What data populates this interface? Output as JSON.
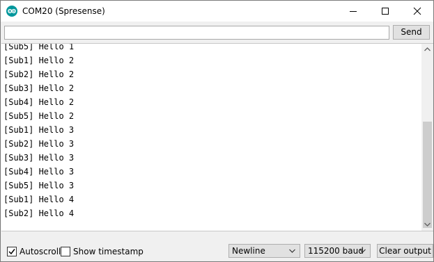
{
  "window": {
    "title": "COM20 (Spresense)",
    "icon": "arduino-logo-icon",
    "accent_color": "#00979c"
  },
  "send_row": {
    "input_value": "",
    "send_label": "Send"
  },
  "serial_output": {
    "lines": [
      "[Sub5] Hello 1",
      "[Sub1] Hello 2",
      "[Sub2] Hello 2",
      "[Sub3] Hello 2",
      "[Sub4] Hello 2",
      "[Sub5] Hello 2",
      "[Sub1] Hello 3",
      "[Sub2] Hello 3",
      "[Sub3] Hello 3",
      "[Sub4] Hello 3",
      "[Sub5] Hello 3",
      "[Sub1] Hello 4",
      "[Sub2] Hello 4"
    ]
  },
  "bottom_bar": {
    "autoscroll": {
      "label": "Autoscroll",
      "checked": true
    },
    "show_timestamp": {
      "label": "Show timestamp",
      "checked": false
    },
    "line_ending": "Newline",
    "baud_rate": "115200 baud",
    "clear_label": "Clear output"
  }
}
